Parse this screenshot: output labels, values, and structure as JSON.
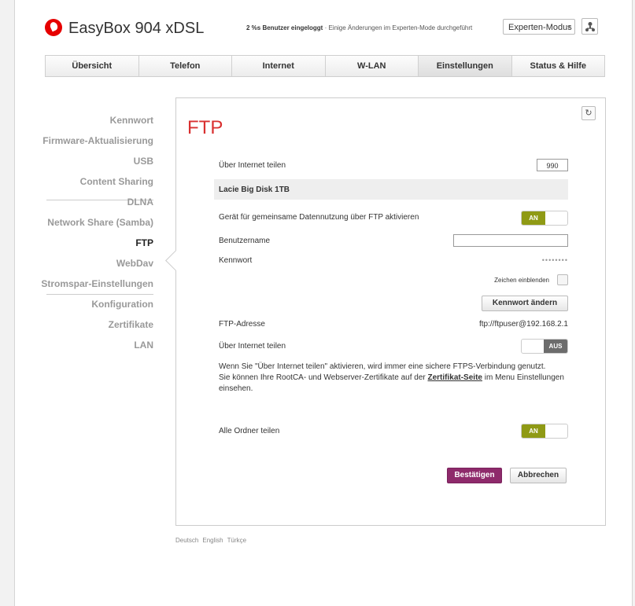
{
  "header": {
    "brand": "EasyBox 904 xDSL",
    "status_bold": "2 %s Benutzer eingeloggt",
    "status_rest": " · Einige Änderungen im Experten-Mode durchgeführt",
    "mode_selected": "Experten-Modus",
    "mode_arrow": "▾"
  },
  "nav": {
    "tabs": [
      "Übersicht",
      "Telefon",
      "Internet",
      "W-LAN",
      "Einstellungen",
      "Status & Hilfe"
    ],
    "active": "Einstellungen"
  },
  "sidebar": {
    "items": [
      "Kennwort",
      "Firmware-Aktualisierung",
      "USB",
      "Content Sharing",
      "DLNA",
      "Network Share (Samba)",
      "FTP",
      "WebDav",
      "Stromspar-Einstellungen",
      "Konfiguration",
      "Zertifikate",
      "LAN"
    ],
    "active": "FTP"
  },
  "main": {
    "title": "FTP",
    "reset_icon": "↻",
    "port_label": "Über Internet teilen",
    "port_value": "990",
    "disk_name": "Lacie Big Disk 1TB",
    "ftp_enable_label": "Gerät für gemeinsame Datennutzung über FTP aktivieren",
    "ftp_enable_state": "AN",
    "username_label": "Benutzername",
    "username_value": "",
    "password_label": "Kennwort",
    "password_value": "••••••••",
    "show_chars_label": "Zeichen einblenden",
    "change_password_label": "Kennwort ändern",
    "ftp_address_label": "FTP-Adresse",
    "ftp_address_value": "ftp://ftpuser@192.168.2.1",
    "internet_share_label": "Über Internet teilen",
    "internet_share_state": "AUS",
    "info_line1": "Wenn Sie \"Über Internet teilen\" aktivieren, wird immer eine sichere FTPS-Verbindung genutzt.",
    "info_line2a": "Sie können Ihre RootCA- und Webserver-Zertifikate auf der ",
    "info_link": "Zertifikat-Seite",
    "info_line2b": " im Menu Einstellungen einsehen.",
    "all_folders_label": "Alle Ordner teilen",
    "all_folders_state": "AN",
    "confirm_label": "Bestätigen",
    "cancel_label": "Abbrechen"
  },
  "footer": {
    "languages": [
      "Deutsch",
      "English",
      "Türkçe"
    ]
  },
  "colors": {
    "brand_red": "#e60000",
    "title_red": "#d93030",
    "toggle_on": "#8f9a15",
    "primary_button": "#8e2a6b"
  }
}
